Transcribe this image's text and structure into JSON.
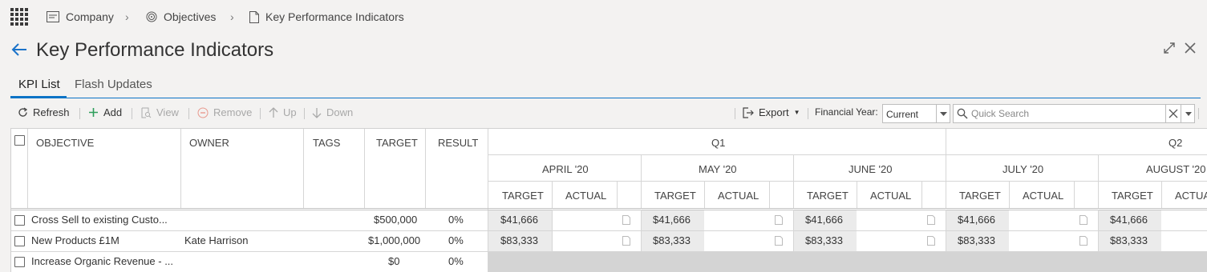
{
  "breadcrumb": {
    "items": [
      "Company",
      "Objectives",
      "Key Performance Indicators"
    ]
  },
  "page": {
    "title": "Key Performance Indicators"
  },
  "tabs": [
    {
      "label": "KPI List",
      "active": true
    },
    {
      "label": "Flash Updates",
      "active": false
    }
  ],
  "toolbar": {
    "refresh": "Refresh",
    "add": "Add",
    "view": "View",
    "remove": "Remove",
    "up": "Up",
    "down": "Down",
    "export": "Export",
    "financial_year_label": "Financial Year:",
    "financial_year_value": "Current",
    "search_placeholder": "Quick Search"
  },
  "grid": {
    "columns": [
      "OBJECTIVE",
      "OWNER",
      "TAGS",
      "TARGET",
      "RESULT"
    ],
    "quarters": [
      "Q1",
      "Q2"
    ],
    "months": [
      "APRIL '20",
      "MAY '20",
      "JUNE '20",
      "JULY '20",
      "AUGUST '20"
    ],
    "sub_target": "TARGET",
    "sub_actual": "ACTUAL",
    "rows": [
      {
        "objective": "Cross Sell to existing Custo...",
        "owner": "",
        "target": "$500,000",
        "result": "0%",
        "monthly": [
          "$41,666",
          "$41,666",
          "$41,666",
          "$41,666",
          "$41,666"
        ]
      },
      {
        "objective": "New Products £1M",
        "owner": "Kate Harrison",
        "target": "$1,000,000",
        "result": "0%",
        "monthly": [
          "$83,333",
          "$83,333",
          "$83,333",
          "$83,333",
          "$83,333"
        ]
      },
      {
        "objective": "Increase Organic Revenue - ...",
        "owner": "",
        "target": "$0",
        "result": "0%",
        "monthly": []
      }
    ]
  },
  "colors": {
    "accent": "#0a73c6",
    "background": "#f3f2f1"
  }
}
